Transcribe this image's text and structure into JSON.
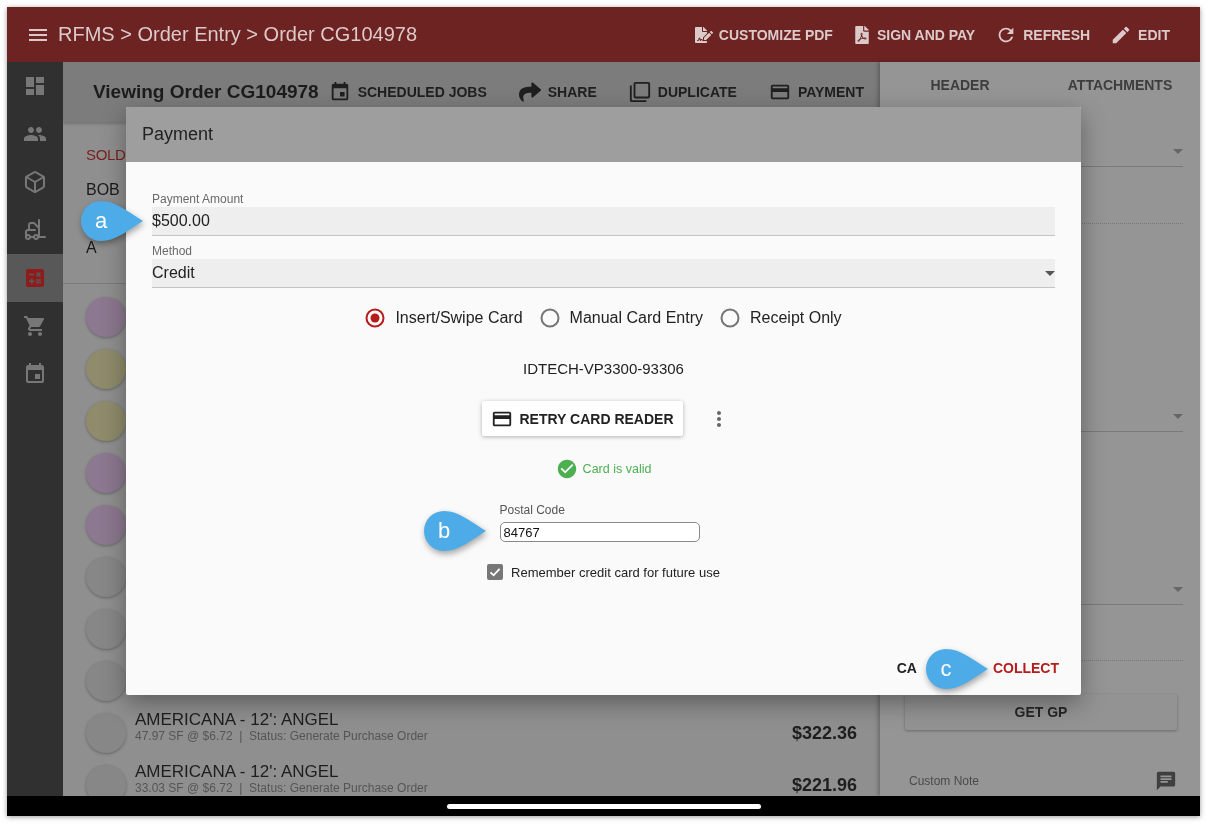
{
  "top_bar": {
    "breadcrumb": "RFMS > Order Entry > Order CG104978",
    "actions": [
      "CUSTOMIZE PDF",
      "SIGN AND PAY",
      "REFRESH",
      "EDIT"
    ]
  },
  "sidebar": {
    "items": [
      {
        "selected": false
      },
      {
        "selected": false
      },
      {
        "selected": false
      },
      {
        "selected": false
      },
      {
        "selected": true
      },
      {
        "selected": false
      },
      {
        "selected": false
      }
    ]
  },
  "order": {
    "title": "Viewing Order CG104978",
    "actions": [
      "SCHEDULED JOBS",
      "SHARE",
      "DUPLICATE",
      "PAYMENT"
    ],
    "sold_to": {
      "heading": "SOLD",
      "lines": [
        "BOB",
        "A"
      ]
    },
    "line_items": [
      {
        "color": "#8c7890"
      },
      {
        "color": "#8f8b6b"
      },
      {
        "color": "#8f8b6b"
      },
      {
        "color": "#8c7890"
      },
      {
        "color": "#8c7890"
      },
      {
        "color": "#878787"
      },
      {
        "color": "#878787"
      },
      {
        "color": "#878787"
      },
      {
        "color": "#878787",
        "title": "AMERICANA - 12': ANGEL",
        "detail": "47.97 SF @ $6.72  |  Status: Generate Purchase Order",
        "price": "$322.36"
      },
      {
        "color": "#878787",
        "title": "AMERICANA - 12': ANGEL",
        "detail": "33.03 SF @ $6.72  |  Status: Generate Purchase Order",
        "price": "$221.96"
      }
    ]
  },
  "right_panel": {
    "tabs": [
      "HEADER",
      "ATTACHMENTS"
    ],
    "fields": [
      {
        "kind": "select"
      },
      {
        "kind": "readonly"
      },
      {
        "kind": "select"
      },
      {
        "kind": "select"
      },
      {
        "kind": "readonly"
      }
    ],
    "get_gp_button": "GET GP",
    "custom_note": {
      "label": "Custom Note"
    }
  },
  "payment_dialog": {
    "title": "Payment",
    "amount": {
      "label": "Payment Amount",
      "value": "$500.00"
    },
    "method": {
      "label": "Method",
      "value": "Credit"
    },
    "entry_modes": [
      {
        "label": "Insert/Swipe Card",
        "selected": true
      },
      {
        "label": "Manual Card Entry",
        "selected": false
      },
      {
        "label": "Receipt Only",
        "selected": false
      }
    ],
    "device": "IDTECH-VP3300-93306",
    "retry_button": "RETRY CARD READER",
    "card_status": "Card is valid",
    "postal_code": {
      "label": "Postal Code",
      "value": "84767"
    },
    "remember_card": {
      "label": "Remember credit card for future use",
      "checked": true
    },
    "buttons": [
      {
        "label": "CA",
        "kind": "cancel"
      },
      {
        "label": "COLLECT",
        "kind": "primary"
      }
    ]
  },
  "callouts": [
    {
      "label": "a"
    },
    {
      "label": "b"
    },
    {
      "label": "c"
    }
  ]
}
